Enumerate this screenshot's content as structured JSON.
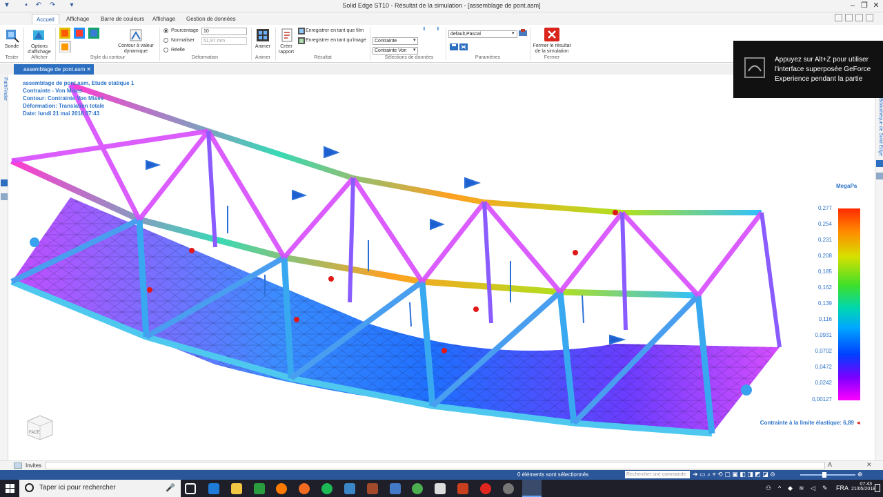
{
  "window": {
    "title": "Solid Edge ST10 - Résultat de la simulation - [assemblage de pont.asm]",
    "minimize": "–",
    "restore": "❐",
    "close": "✕"
  },
  "ribbon": {
    "tabs": [
      {
        "label": "Accueil",
        "active": true
      },
      {
        "label": "Affichage"
      },
      {
        "label": "Barre de couleurs"
      },
      {
        "label": "Affichage"
      },
      {
        "label": "Gestion de données"
      }
    ],
    "groups": {
      "tester": {
        "button": "Sonde",
        "label": "Tester"
      },
      "afficher": {
        "button": "Options d'affichage",
        "label": "Afficher"
      },
      "style": {
        "button": "Contour à valeur dynamique",
        "label": "Style du contour"
      },
      "deformation": {
        "label": "Déformation",
        "options": [
          "Pourcentage",
          "Normaliser",
          "Réelle"
        ],
        "percent_value": "10",
        "normalize_value": "51,97 mm"
      },
      "animer": {
        "button": "Animer",
        "label": "Animer"
      },
      "resultat": {
        "button": "Créer rapport",
        "save_film": "Enregistrer en tant que film",
        "save_image": "Enregistrer en tant qu'image",
        "label": "Résultat"
      },
      "selection": {
        "label": "Sélections de données",
        "select1": "Contrainte",
        "select2": "Contrainte Von"
      },
      "parametres": {
        "label": "Paramètres",
        "profile": "default,Pascal"
      },
      "fermer": {
        "button": "Fermer le résultat de la simulation",
        "label": "Fermer"
      }
    }
  },
  "document_tab": {
    "label": "assemblage de pont.asm",
    "close": "✕"
  },
  "left_strip": {
    "label": "PathFinder"
  },
  "right_strip": {
    "label": "Bibliothèque de Solid Edge"
  },
  "study_info": [
    "assemblage de pont.asm, Etude statique 1",
    "Contrainte - Von Mises",
    "Contour: Contrainte Von Mises",
    "Déformation: Translation totale",
    "Date: lundi 21 mai 2018  07:43"
  ],
  "overlay": {
    "text": "Appuyez sur Alt+Z pour utiliser l'interface superposée GeForce Experience pendant la partie"
  },
  "legend": {
    "unit": "MegaPa",
    "ticks": [
      "0,277",
      "0,254",
      "0,231",
      "0,208",
      "0,185",
      "0,162",
      "0,139",
      "0,116",
      "0,0931",
      "0,0702",
      "0,0472",
      "0,0242",
      "0,00127"
    ],
    "yield_text": "Contrainte à la limite élastique: 6,89"
  },
  "view_cube": {
    "label": "FACE"
  },
  "invites": {
    "label": "Invites"
  },
  "status": {
    "selection": "0 éléments sont sélectionnés",
    "search_placeholder": "Rechercher une commande"
  },
  "taskbar": {
    "search_placeholder": "Taper ici pour rechercher",
    "language": "FRA",
    "time": "07:43",
    "date": "21/05/2018"
  },
  "colors": {
    "accent": "#2b579a",
    "info_text": "#2e74c9",
    "doc_tab": "#2c6fc0",
    "close_button": "#d9251c",
    "taskbar": "#1f1f2a"
  }
}
